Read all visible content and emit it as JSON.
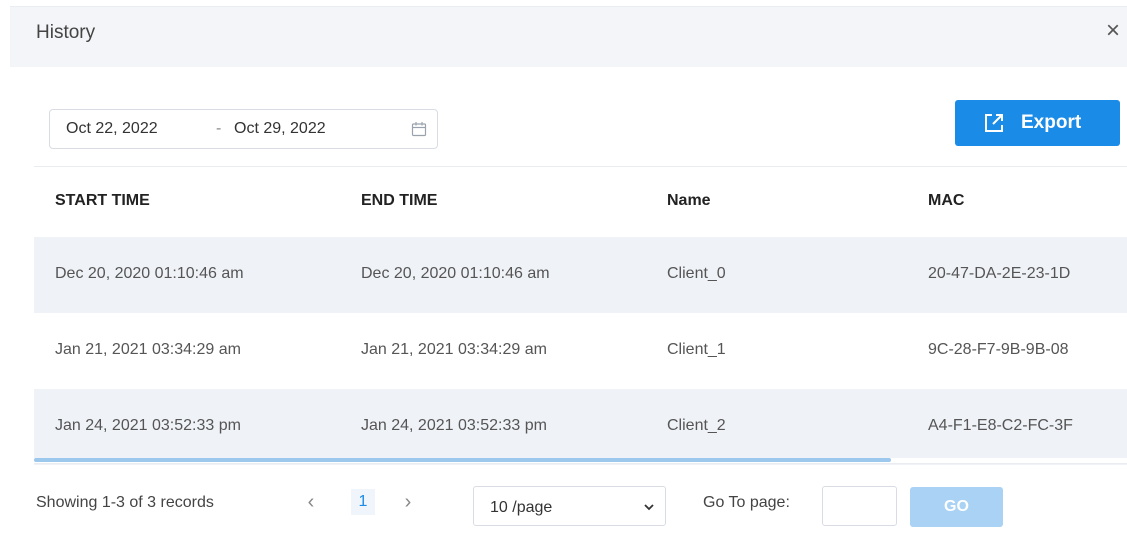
{
  "dialog": {
    "title": "History",
    "close_glyph": "×"
  },
  "date_range": {
    "start": "Oct 22, 2022",
    "separator": "-",
    "end": "Oct 29, 2022",
    "icon": "calendar-icon"
  },
  "toolbar": {
    "export_label": "Export",
    "export_icon": "external-link-icon",
    "accent_color": "#1a8be6"
  },
  "table": {
    "columns": [
      "START TIME",
      "END TIME",
      "Name",
      "MAC"
    ],
    "rows": [
      [
        "Dec 20, 2020 01:10:46 am",
        "Dec 20, 2020 01:10:46 am",
        "Client_0",
        "20-47-DA-2E-23-1D"
      ],
      [
        "Jan 21, 2021 03:34:29 am",
        "Jan 21, 2021 03:34:29 am",
        "Client_1",
        "9C-28-F7-9B-9B-08"
      ],
      [
        "Jan 24, 2021 03:52:33 pm",
        "Jan 24, 2021 03:52:33 pm",
        "Client_2",
        "A4-F1-E8-C2-FC-3F"
      ]
    ]
  },
  "pagination": {
    "showing_text": "Showing 1-3 of 3 records",
    "prev_glyph": "‹",
    "current_page": "1",
    "next_glyph": "›",
    "page_size": "10 /page",
    "goto_label": "Go To page:",
    "goto_value": "",
    "go_label": "GO"
  }
}
